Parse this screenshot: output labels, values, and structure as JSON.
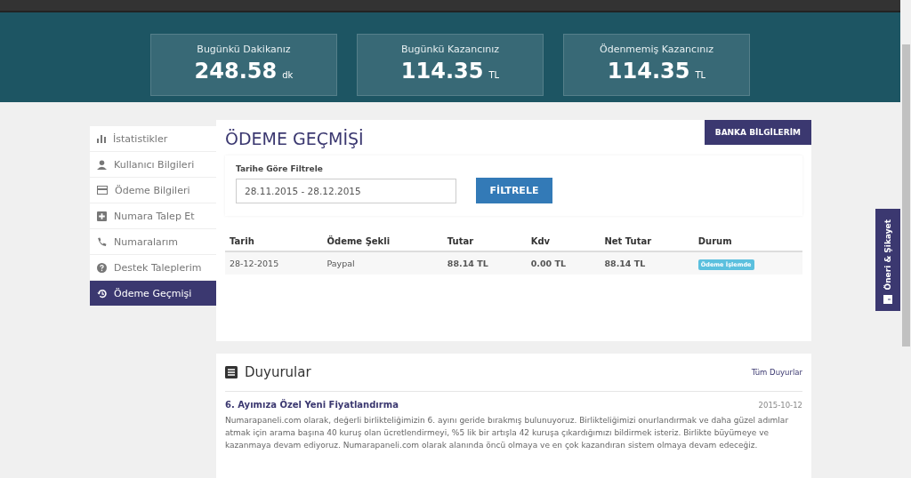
{
  "stats": [
    {
      "label": "Bugünkü Dakikanız",
      "value": "248.58",
      "unit": "dk"
    },
    {
      "label": "Bugünkü Kazancınız",
      "value": "114.35",
      "unit": "TL"
    },
    {
      "label": "Ödenmemiş Kazancınız",
      "value": "114.35",
      "unit": "TL"
    }
  ],
  "sidebar": {
    "items": [
      {
        "label": "İstatistikler",
        "selected": false
      },
      {
        "label": "Kullanıcı Bilgileri",
        "selected": false
      },
      {
        "label": "Ödeme Bilgileri",
        "selected": false
      },
      {
        "label": "Numara Talep Et",
        "selected": false
      },
      {
        "label": "Numaralarım",
        "selected": false
      },
      {
        "label": "Destek Taleplerim",
        "selected": false
      },
      {
        "label": "Ödeme Geçmişi",
        "selected": true
      }
    ]
  },
  "page_title": "ÖDEME GEÇMİŞİ",
  "bank_button": "BANKA BİLGİLERİM",
  "filter": {
    "label": "Tarihe Göre Filtrele",
    "value": "28.11.2015 - 28.12.2015",
    "button": "FİLTRELE"
  },
  "table": {
    "columns": [
      "Tarih",
      "Ödeme Şekli",
      "Tutar",
      "Kdv",
      "Net Tutar",
      "Durum"
    ],
    "rows": [
      {
        "cells": [
          "28-12-2015",
          "Paypal",
          "88.14 TL",
          "0.00 TL",
          "88.14 TL"
        ],
        "status": "Ödeme İşlemde"
      }
    ]
  },
  "announcements": {
    "title": "Duyurular",
    "all_link": "Tüm Duyurlar",
    "items": [
      {
        "title": "6. Ayımıza Özel Yeni Fiyatlandırma",
        "date": "2015-10-12",
        "body": "Numarapaneli.com olarak, değerli birlikteliğimizin 6. ayını geride bırakmış bulunuyoruz. Birlikteliğimizi onurlandırmak ve daha güzel adımlar atmak için arama başına 40 kuruş olan ücretlendirmeyi, %5 lik bir artışla 42 kuruşa çıkardığımızı bildirmek isteriz. Birlikte büyümeye ve kazanmaya devam ediyoruz. Numarapaneli.com olarak alanında öncü olmaya ve en çok kazandıran sistem olmaya devam edeceğiz."
      }
    ]
  },
  "feedback_tab": "Öneri & Şikayet"
}
